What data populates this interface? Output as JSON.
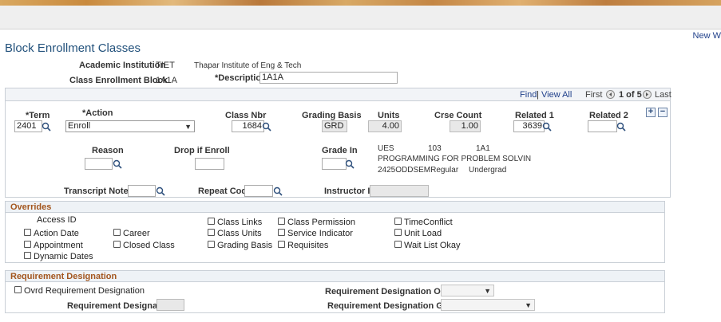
{
  "header": {
    "new_window": "New W"
  },
  "page_title": "Block Enrollment Classes",
  "form": {
    "academic_institution_label": "Academic Institution",
    "academic_institution_code": "TIET",
    "academic_institution_name": "Thapar Institute of Eng & Tech",
    "class_enrollment_block_label": "Class Enrollment Block",
    "class_enrollment_block_value": "1A1A",
    "description_label": "*Description",
    "description_value": "1A1A"
  },
  "grid_nav": {
    "find": "Find",
    "separator": "|",
    "view_all": "View All",
    "first": "First",
    "range": "1 of 5",
    "last": "Last"
  },
  "row": {
    "term_label": "*Term",
    "term_value": "2401",
    "action_label": "*Action",
    "action_value": "Enroll",
    "class_nbr_label": "Class Nbr",
    "class_nbr_value": "1684",
    "grading_basis_label": "Grading Basis",
    "grading_basis_value": "GRD",
    "units_label": "Units",
    "units_value": "4.00",
    "crse_count_label": "Crse Count",
    "crse_count_value": "1.00",
    "related1_label": "Related 1",
    "related1_value": "3639",
    "related2_label": "Related 2",
    "related2_value": "",
    "reason_label": "Reason",
    "drop_if_enroll_label": "Drop if Enroll",
    "grade_in_label": "Grade In",
    "class_subject": "UES",
    "class_catalog": "103",
    "class_section": "1A1",
    "class_title": "PROGRAMMING FOR PROBLEM SOLVIN",
    "class_session": "2425ODDSEMRegular",
    "class_career": "Undergrad",
    "transcript_note_label": "Transcript Note ID",
    "repeat_code_label": "Repeat Code",
    "instructor_id_label": "Instructor ID"
  },
  "overrides": {
    "title": "Overrides",
    "access_id": "Access ID",
    "action_date": "Action Date",
    "career": "Career",
    "appointment": "Appointment",
    "closed_class": "Closed Class",
    "dynamic_dates": "Dynamic Dates",
    "class_links": "Class Links",
    "class_units": "Class Units",
    "grading_basis": "Grading Basis",
    "class_permission": "Class Permission",
    "service_indicator": "Service Indicator",
    "requisites": "Requisites",
    "time_conflict": "TimeConflict",
    "unit_load": "Unit Load",
    "wait_list_okay": "Wait List Okay"
  },
  "requirement": {
    "title": "Requirement Designation",
    "ovrd_label": "Ovrd Requirement Designation",
    "designation_label": "Requirement Designation",
    "option_label": "Requirement Designation Option",
    "grade_label": "Requirement Designation Grade"
  },
  "icons": [
    "search-icon",
    "chevron-down-icon",
    "prev-arrow-icon",
    "next-arrow-icon",
    "add-row-icon",
    "delete-row-icon"
  ]
}
